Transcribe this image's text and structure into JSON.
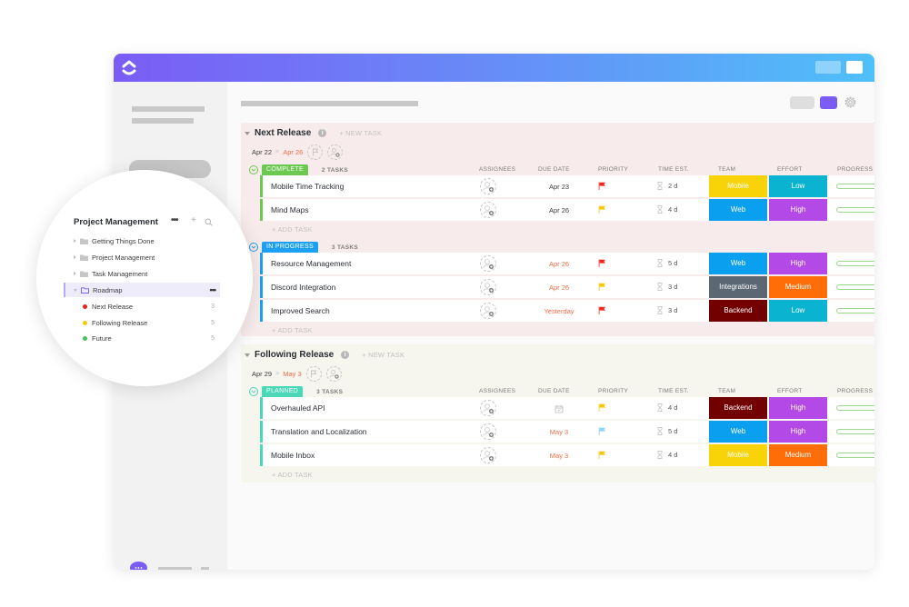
{
  "colors": {
    "accent": "#7b5cf5",
    "complete": "#6bc950",
    "in_progress": "#1ea0f2",
    "planned": "#4ad8b9",
    "due_overdue": "#f26d45",
    "due_normal": "#3d3d3d"
  },
  "columns": {
    "assignees": "ASSIGNEES",
    "due_date": "DUE DATE",
    "priority": "PRIORITY",
    "time_est": "TIME EST.",
    "team": "TEAM",
    "effort": "EFFORT",
    "progress": "PROGRESS"
  },
  "sidebar_popup": {
    "title": "Project Management",
    "more_icon": "ellipsis-icon",
    "add_icon": "+",
    "search_icon": "search-icon",
    "folders": [
      {
        "label": "Getting Things Done"
      },
      {
        "label": "Project Management"
      },
      {
        "label": "Task Management"
      },
      {
        "label": "Roadmap",
        "more": "•••"
      }
    ],
    "lists": [
      {
        "label": "Next Release",
        "count": "3",
        "color": "#e8231a"
      },
      {
        "label": "Following Release",
        "count": "5",
        "color": "#f7c708"
      },
      {
        "label": "Future",
        "count": "5",
        "color": "#3dc55a"
      }
    ]
  },
  "groups": [
    {
      "title": "Next Release",
      "info_icon": "i",
      "new_task": "+ NEW TASK",
      "start_date": "Apr 22",
      "arrow": ">",
      "end_date": "Apr 26",
      "statuses": [
        {
          "label": "COMPLETE",
          "color": "#6bc950",
          "count": "2 TASKS",
          "add_task": "+ ADD TASK",
          "tasks": [
            {
              "name": "Mobile Time Tracking",
              "due": "Apr 23",
              "due_color": "#3d3d3d",
              "priority": "urgent",
              "flag_color": "#f0281a",
              "est": "2 d",
              "team": "Mobile",
              "team_color": "#f7d308",
              "effort": "Low",
              "effort_color": "#0ab4d0",
              "progress": 0
            },
            {
              "name": "Mind Maps",
              "due": "Apr 26",
              "due_color": "#3d3d3d",
              "priority": "high",
              "flag_color": "#f7c708",
              "est": "4 d",
              "team": "Web",
              "team_color": "#0b9ff0",
              "effort": "High",
              "effort_color": "#b349e6",
              "progress": 0
            }
          ]
        },
        {
          "label": "IN PROGRESS",
          "color": "#1ea0f2",
          "count": "3 TASKS",
          "add_task": "+ ADD TASK",
          "tasks": [
            {
              "name": "Resource Management",
              "due": "Apr 26",
              "due_color": "#f26d45",
              "priority": "urgent",
              "flag_color": "#f0281a",
              "est": "5 d",
              "team": "Web",
              "team_color": "#0b9ff0",
              "effort": "High",
              "effort_color": "#b349e6",
              "progress": 0
            },
            {
              "name": "Discord Integration",
              "due": "Apr 26",
              "due_color": "#f26d45",
              "priority": "high",
              "flag_color": "#f7c708",
              "est": "3 d",
              "team": "Integrations",
              "team_color": "#5b6773",
              "effort": "Medium",
              "effort_color": "#ff6d08",
              "progress": 0
            },
            {
              "name": "Improved Search",
              "due": "Yesterday",
              "due_color": "#f26d45",
              "priority": "urgent",
              "flag_color": "#f0281a",
              "est": "3 d",
              "team": "Backend",
              "team_color": "#720000",
              "effort": "Low",
              "effort_color": "#0ab4d0",
              "progress": 0
            }
          ]
        }
      ]
    },
    {
      "title": "Following Release",
      "info_icon": "i",
      "new_task": "+ NEW TASK",
      "start_date": "Apr 29",
      "arrow": ">",
      "end_date": "May 3",
      "statuses": [
        {
          "label": "PLANNED",
          "color": "#4ad8b9",
          "count": "3 TASKS",
          "add_task": "+ ADD TASK",
          "tasks": [
            {
              "name": "Overhauled API",
              "due": "",
              "due_icon": "calendar-icon",
              "due_color": "#3d3d3d",
              "priority": "high",
              "flag_color": "#f7c708",
              "est": "4 d",
              "team": "Backend",
              "team_color": "#720000",
              "effort": "High",
              "effort_color": "#b349e6",
              "progress": 0
            },
            {
              "name": "Translation and Localization",
              "due": "May 3",
              "due_color": "#f26d45",
              "priority": "normal",
              "flag_color": "#8ad2f7",
              "est": "5 d",
              "team": "Web",
              "team_color": "#0b9ff0",
              "effort": "High",
              "effort_color": "#b349e6",
              "progress": 0
            },
            {
              "name": "Mobile Inbox",
              "due": "May 3",
              "due_color": "#f26d45",
              "priority": "high",
              "flag_color": "#f7c708",
              "est": "4 d",
              "team": "Mobile",
              "team_color": "#f7d308",
              "effort": "Medium",
              "effort_color": "#ff6d08",
              "progress": 0
            }
          ]
        }
      ]
    }
  ]
}
